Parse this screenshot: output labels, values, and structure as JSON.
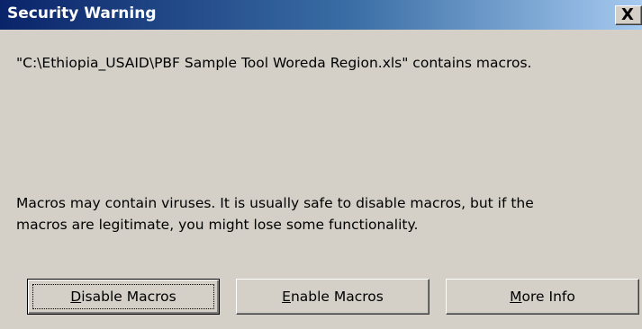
{
  "window": {
    "title": "Security Warning",
    "close_label": "X"
  },
  "message": "\"C:\\Ethiopia_USAID\\PBF Sample Tool Woreda Region.xls\" contains macros.",
  "warning": {
    "line1": "Macros may contain viruses. It is usually safe to disable macros, but if the",
    "line2": "macros are legitimate, you might lose some functionality."
  },
  "buttons": {
    "disable": {
      "mnemonic": "D",
      "rest": "isable Macros"
    },
    "enable": {
      "mnemonic": "E",
      "rest": "nable Macros"
    },
    "more": {
      "mnemonic": "M",
      "rest": "ore Info"
    }
  },
  "colors": {
    "title_gradient_start": "#0a246a",
    "title_gradient_end": "#a6caf0",
    "dialog_face": "#d4d0c8"
  }
}
